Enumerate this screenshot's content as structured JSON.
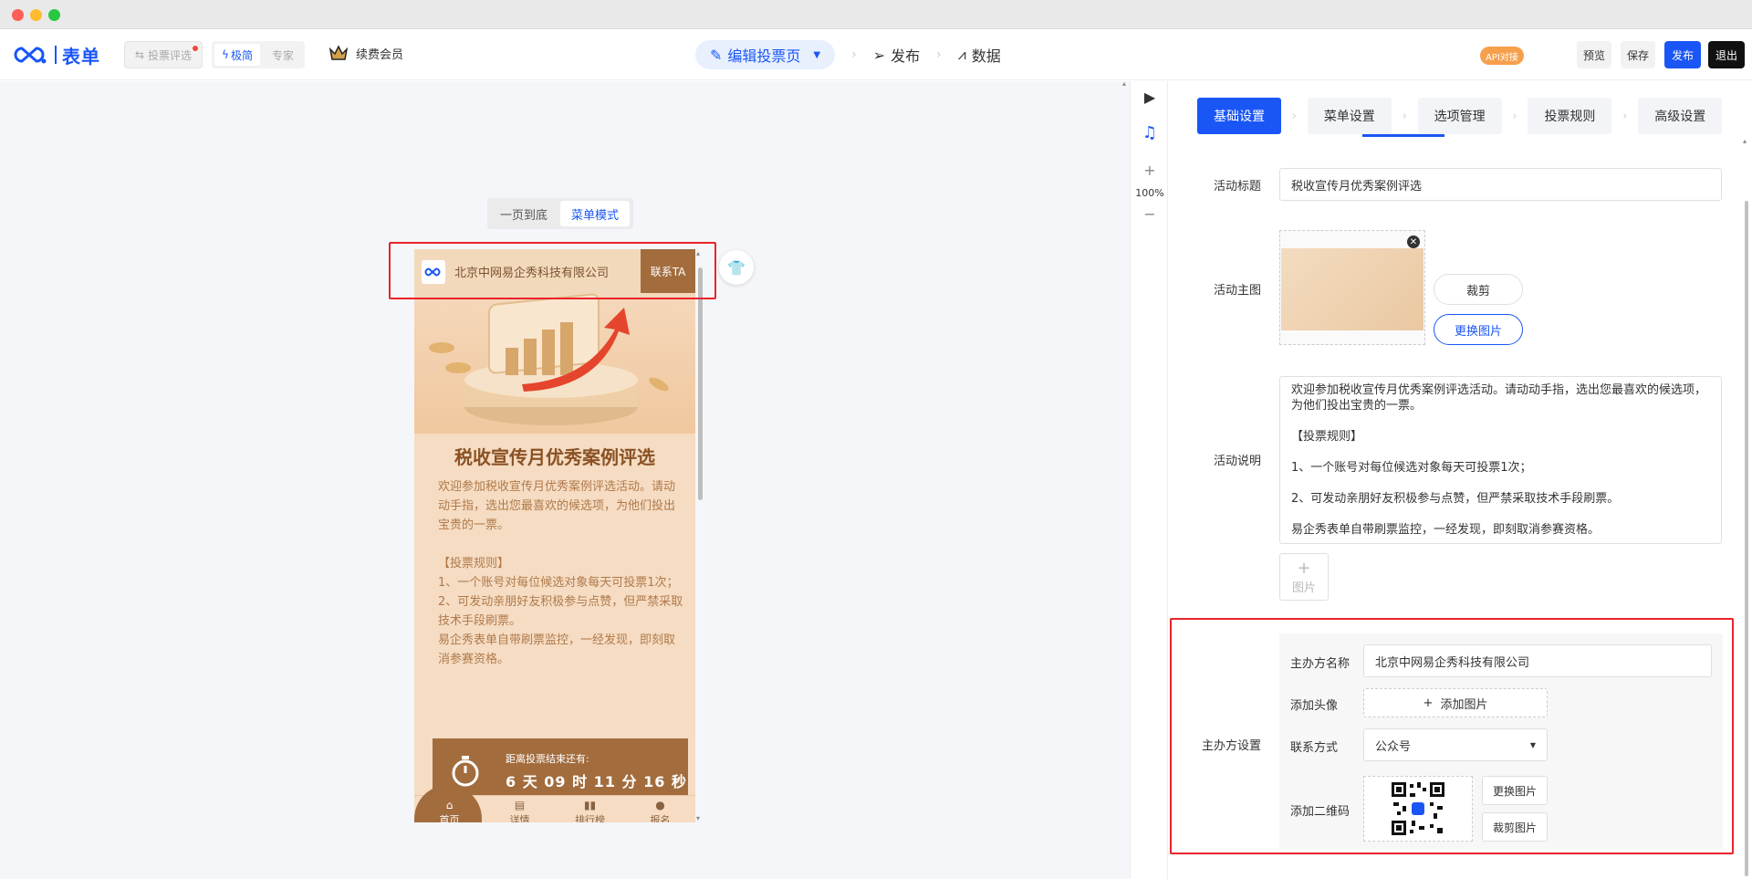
{
  "app": {
    "logo_text": "表单",
    "modes": {
      "vote": "投票评选",
      "simple": "极简",
      "expert": "专家"
    },
    "vip_label": "续费会员"
  },
  "steps": {
    "edit": "编辑投票页",
    "publish": "发布",
    "data": "数据"
  },
  "toolbar": {
    "api_badge": "API对接",
    "preview": "预览",
    "save": "保存",
    "publish": "发布",
    "exit": "退出"
  },
  "canvas": {
    "view_modes": [
      "一页到底",
      "菜单模式"
    ],
    "active_view": "菜单模式",
    "zoom": "100%"
  },
  "phone": {
    "org_name": "北京中网易企秀科技有限公司",
    "contact_button": "联系TA",
    "title": "税收宣传月优秀案例评选",
    "description": "欢迎参加税收宣传月优秀案例评选活动。请动动手指，选出您最喜欢的候选项，为他们投出宝贵的一票。\n\n【投票规则】\n1、一个账号对每位候选对象每天可投票1次；\n2、可发动亲朋好友积极参与点赞，但严禁采取技术手段刷票。\n易企秀表单自带刷票监控，一经发现，即刻取消参赛资格。",
    "countdown_label": "距离投票结束还有:",
    "countdown_time": "6 天 09 时 11 分 16 秒",
    "tabs": [
      "首页",
      "详情",
      "排行榜",
      "报名"
    ],
    "active_tab": "首页"
  },
  "panel": {
    "tabs": [
      "基础设置",
      "菜单设置",
      "选项管理",
      "投票规则",
      "高级设置"
    ],
    "active_tab": "基础设置",
    "fields": {
      "title_label": "活动标题",
      "title_value": "税收宣传月优秀案例评选",
      "cover_label": "活动主图",
      "crop_button": "裁剪",
      "replace_button": "更换图片",
      "desc_label": "活动说明",
      "desc_value": "欢迎参加税收宣传月优秀案例评选活动。请动动手指，选出您最喜欢的候选项，为他们投出宝贵的一票。\n\n【投票规则】\n\n1、一个账号对每位候选对象每天可投票1次；\n\n2、可发动亲朋好友积极参与点赞，但严禁采取技术手段刷票。\n\n易企秀表单自带刷票监控，一经发现，即刻取消参赛资格。",
      "add_image": "图片"
    },
    "host": {
      "section_label": "主办方设置",
      "name_label": "主办方名称",
      "name_value": "北京中网易企秀科技有限公司",
      "avatar_label": "添加头像",
      "avatar_button": "添加图片",
      "contact_label": "联系方式",
      "contact_value": "公众号",
      "qr_label": "添加二维码",
      "qr_replace": "更换图片",
      "qr_crop": "裁剪图片"
    }
  },
  "colors": {
    "brand": "#1a56f6",
    "theme_brown": "#a36c3d",
    "highlight_red": "#e8242b"
  }
}
